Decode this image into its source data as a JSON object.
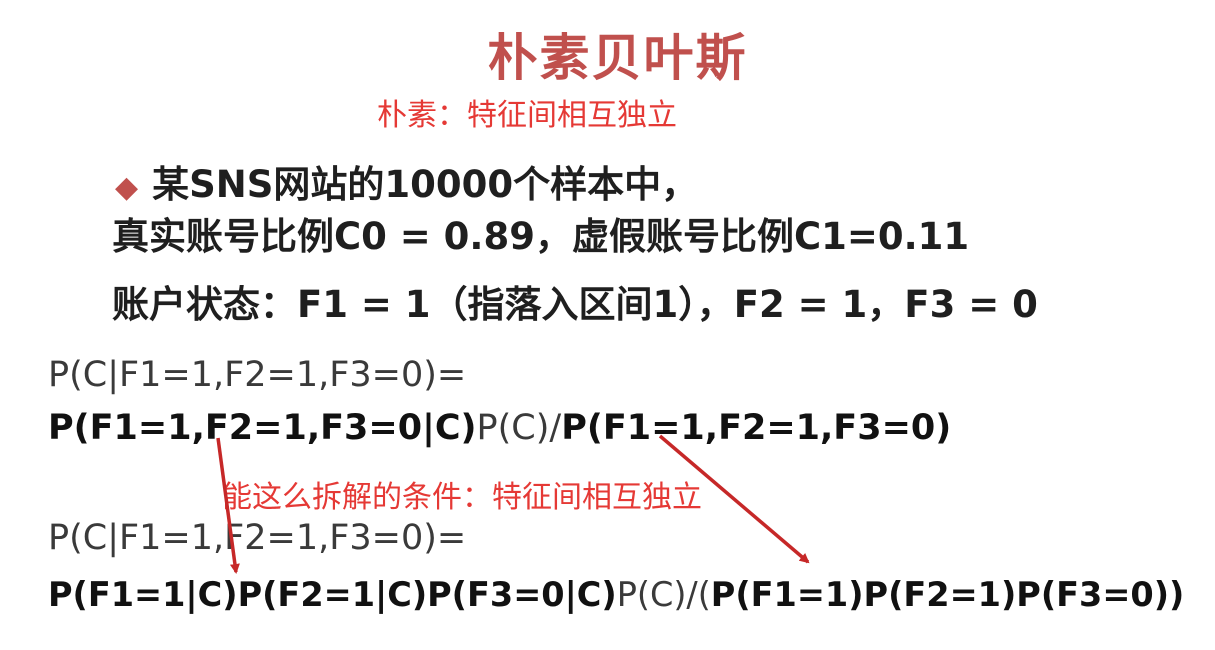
{
  "title": "朴素贝叶斯",
  "note_naive": "朴素：特征间相互独立",
  "bullet": "某SNS网站的10000个样本中，",
  "line2": "真实账号比例C0 = 0.89，虚假账号比例C1=0.11",
  "line3": "账户状态：F1 = 1（指落入区间1），F2 = 1，F3 = 0",
  "formula1": "P(C|F1=1,F2=1,F3=0)=",
  "formula2": {
    "p1": "P(F1=1,F2=1,F3=0|C)",
    "p2": "P(C)/",
    "p3": "P(F1=1,F2=1,F3=0)"
  },
  "note_condition": "能这么拆解的条件：特征间相互独立",
  "formula3": "P(C|F1=1,F2=1,F3=0)=",
  "formula4": {
    "p1": "P(F1=1|C)P(F2=1|C)P(F3=0|C)",
    "p2": "P(C)/(",
    "p3": "P(F1=1)P(F2=1)P(F3=0))"
  },
  "colors": {
    "title": "#c0504d",
    "annotation": "#e53935",
    "arrow": "#c62828"
  }
}
